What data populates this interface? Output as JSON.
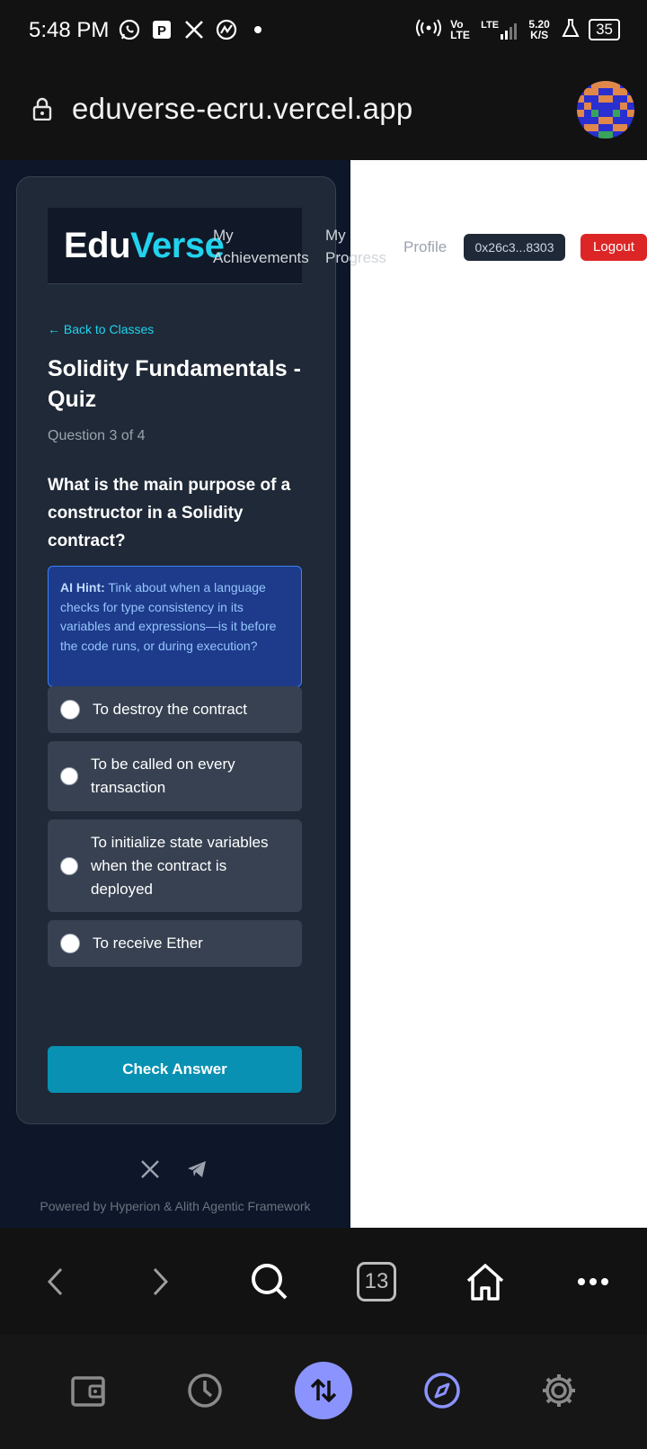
{
  "status_bar": {
    "time": "5:48 PM",
    "network": "Vo LTE",
    "signal": "LTE",
    "speed": "5.20 K/S",
    "battery": "35"
  },
  "address_bar": {
    "url": "eduverse-ecru.vercel.app"
  },
  "header": {
    "logo_part1": "Edu",
    "logo_part2": "Verse",
    "nav_achievements_line1": "My",
    "nav_achievements_line2": "Achievements",
    "nav_progress_line1": "My",
    "nav_progress_line2": "Progress",
    "nav_profile": "Profile",
    "wallet_address": "0x26c3...8303",
    "logout_label": "Logout"
  },
  "quiz": {
    "back_link": "← Back to Classes",
    "title": "Solidity Fundamentals - Quiz",
    "question_counter": "Question 3 of 4",
    "question": "What is the main purpose of a constructor in a Solidity contract?",
    "hint_label": "AI Hint:",
    "hint_text": "Tink about when a language checks for type consistency in its variables and expressions—is it before the code runs, or during execution?",
    "options": [
      "To destroy the contract",
      "To be called on every transaction",
      "To initialize state variables when the contract is deployed",
      "To receive Ether"
    ],
    "check_button": "Check Answer"
  },
  "footer": {
    "powered_by": "Powered by Hyperion & Alith Agentic Framework"
  },
  "browser_toolbar": {
    "tab_count": "13"
  }
}
